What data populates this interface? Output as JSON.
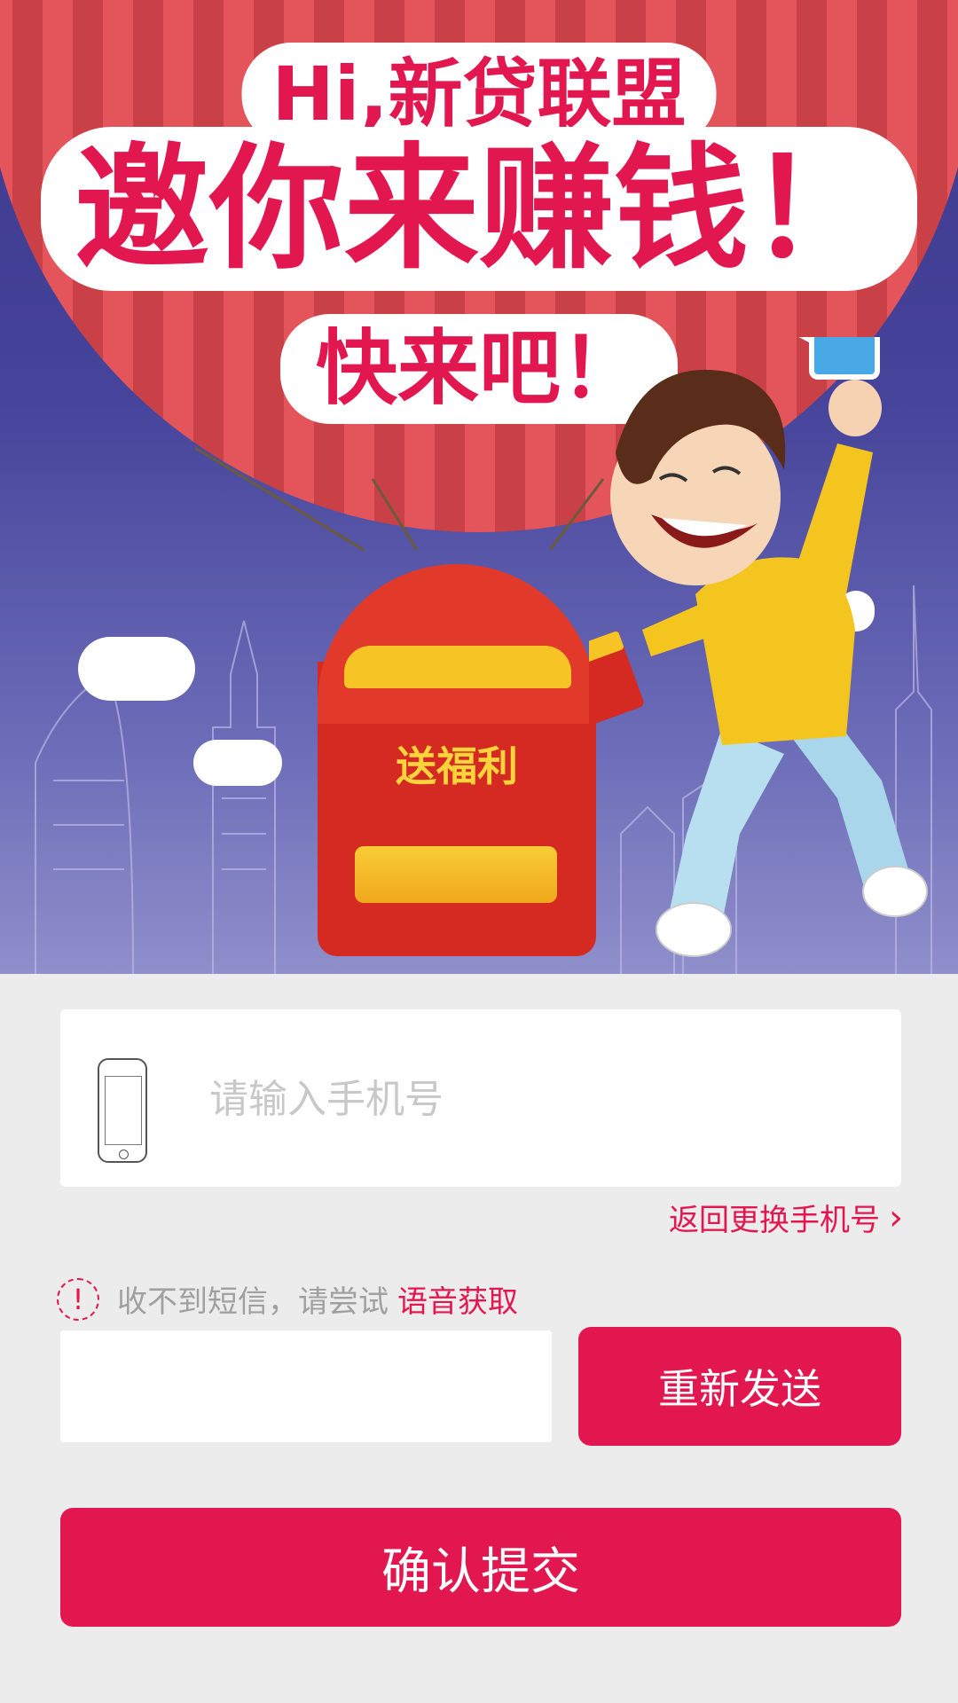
{
  "banner": {
    "line1": "Hi,新贷联盟",
    "line2": "邀你来赚钱！",
    "line3": "快来吧！"
  },
  "envelope": {
    "title": "送福利"
  },
  "phone": {
    "placeholder": "请输入手机号",
    "value": ""
  },
  "back_link": {
    "label": "返回更换手机号"
  },
  "hint": {
    "text": "收不到短信，请尝试",
    "link": "语音获取"
  },
  "code": {
    "value": ""
  },
  "buttons": {
    "resend": "重新发送",
    "submit": "确认提交"
  },
  "colors": {
    "accent": "#e3174f",
    "page_background": "#ececec",
    "sky": "#45439a"
  }
}
